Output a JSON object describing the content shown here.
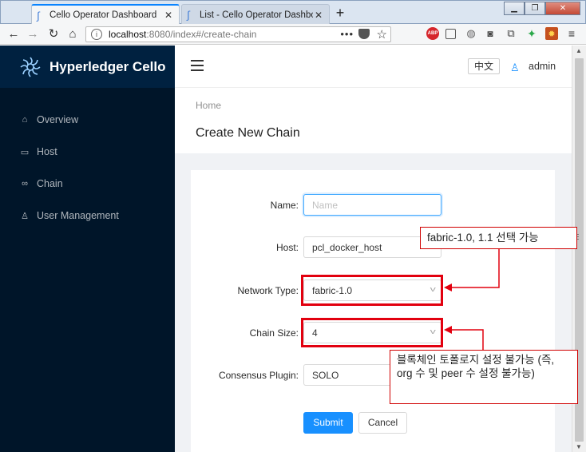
{
  "browser": {
    "tabs": [
      {
        "title": "Cello Operator Dashboard",
        "active": true
      },
      {
        "title": "List - Cello Operator Dashboard",
        "active": false
      }
    ],
    "url_host": "localhost",
    "url_rest": ":8080/index#/create-chain",
    "url_menu": "•••",
    "new_tab": "+",
    "extensions": [
      "abp-icon",
      "reader-icon",
      "globe-icon",
      "camera-icon",
      "fox-icon",
      "gear-icon",
      "menu-icon"
    ],
    "abp_label": "ABP"
  },
  "app": {
    "brand": "Hyperledger Cello",
    "sidebar": {
      "items": [
        {
          "label": "Overview",
          "icon": "home-icon"
        },
        {
          "label": "Host",
          "icon": "laptop-icon"
        },
        {
          "label": "Chain",
          "icon": "link-icon"
        },
        {
          "label": "User Management",
          "icon": "user-icon"
        }
      ]
    },
    "header": {
      "lang": "中文",
      "user": "admin"
    },
    "breadcrumb": "Home",
    "page_title": "Create New Chain"
  },
  "form": {
    "name_label": "Name:",
    "name_placeholder": "Name",
    "host_label": "Host:",
    "host_value": "pcl_docker_host",
    "network_label": "Network Type:",
    "network_value": "fabric-1.0",
    "size_label": "Chain Size:",
    "size_value": "4",
    "consensus_label": "Consensus Plugin:",
    "consensus_value": "SOLO",
    "submit": "Submit",
    "cancel": "Cancel"
  },
  "annotations": {
    "callout_1": "fabric-1.0, 1.1 선택 가능",
    "callout_2": "블록체인 토폴로지 설정 불가능 (즉, org 수 및 peer 수 설정 불가능)",
    "color": "#e2000f"
  }
}
